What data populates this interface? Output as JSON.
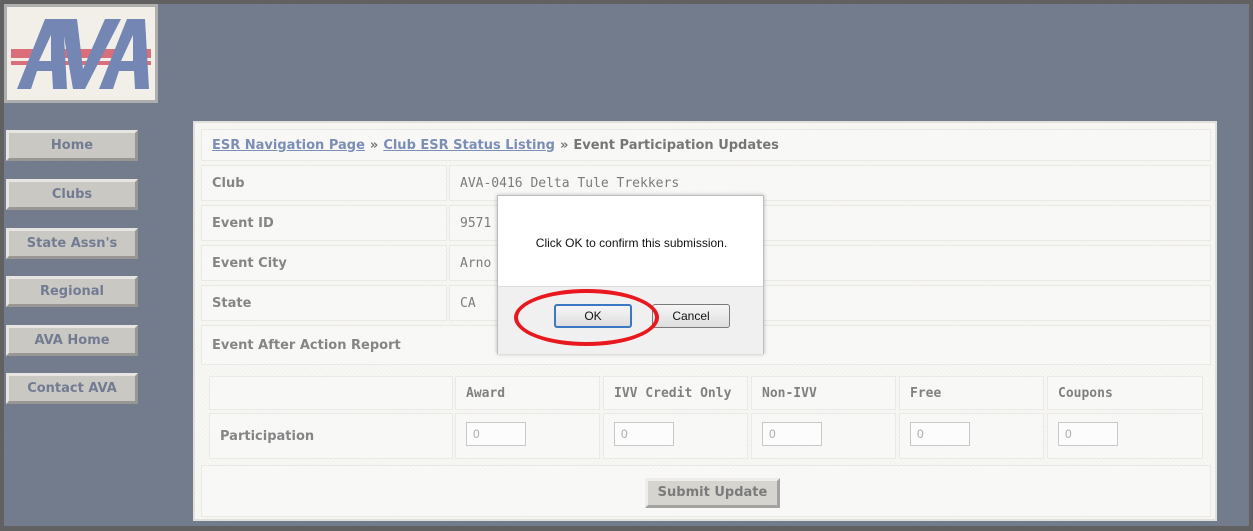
{
  "logo": {
    "text": "AVA",
    "icon": "ava-logo"
  },
  "sidebar": {
    "items": [
      {
        "label": "Home"
      },
      {
        "label": "Clubs"
      },
      {
        "label": "State Assn's"
      },
      {
        "label": "Regional"
      },
      {
        "label": "AVA Home"
      },
      {
        "label": "Contact AVA"
      }
    ]
  },
  "breadcrumb": {
    "link1": "ESR Navigation Page",
    "sep1": "»",
    "link2": "Club ESR Status Listing",
    "sep2": "»",
    "current": "Event Participation Updates"
  },
  "details": {
    "club_label": "Club",
    "club_value": "AVA-0416 Delta Tule Trekkers",
    "event_id_label": "Event ID",
    "event_id_value": "9571",
    "event_city_label": "Event City",
    "event_city_value": "Arno",
    "state_label": "State",
    "state_value": "CA",
    "report_label": "Event After Action Report"
  },
  "participation": {
    "columns": [
      "Award",
      "IVV Credit Only",
      "Non-IVV",
      "Free",
      "Coupons"
    ],
    "row_label": "Participation",
    "values": [
      "0",
      "0",
      "0",
      "0",
      "0"
    ]
  },
  "submit_label": "Submit Update",
  "dialog": {
    "message": "Click OK to confirm this submission.",
    "ok_label": "OK",
    "cancel_label": "Cancel"
  },
  "colors": {
    "background": "#1b2a45",
    "highlight": "#e8181e",
    "link": "#2b4a8a"
  }
}
